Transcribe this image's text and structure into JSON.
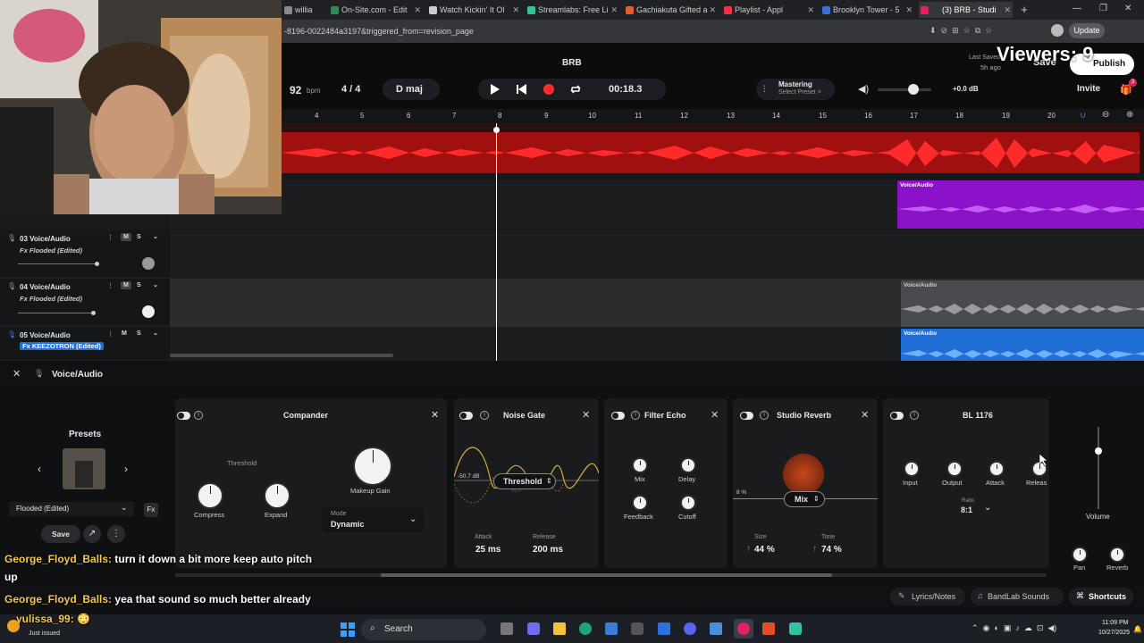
{
  "browser": {
    "tabs": [
      {
        "title": "willia",
        "color": "#8a8a8a"
      },
      {
        "title": "On-Site.com - Edit",
        "color": "#2e8b57"
      },
      {
        "title": "Watch Kickin' It Ol",
        "color": "#cccccc"
      },
      {
        "title": "Streamlabs: Free Li",
        "color": "#31c3a2"
      },
      {
        "title": "Gachiakuta Gifted a",
        "color": "#e65c2e"
      },
      {
        "title": "Playlist - Appl",
        "color": "#fa2d48"
      },
      {
        "title": "Brooklyn Tower - 5",
        "color": "#3b6fd8"
      },
      {
        "title": "(3) BRB - Studi",
        "color": "#e0245e"
      }
    ],
    "url": "-8196-0022484a3197&triggered_from=revision_page",
    "update_label": "Update"
  },
  "stream": {
    "viewers_label": "Viewers: 9"
  },
  "header": {
    "title": "BRB",
    "bpm_value": "92",
    "bpm_unit": "bpm",
    "time_signature": "4 / 4",
    "key": "D maj",
    "time": "00:18.3",
    "mastering_label": "Mastering",
    "mastering_preset": "Select Preset >",
    "master_volume": "+0.0 dB",
    "last_saved_label": "Last Saved",
    "last_saved_time": "5h ago",
    "save_label": "Save",
    "publish_label": "Publish",
    "invite_label": "Invite",
    "notification_count": "3"
  },
  "ruler": {
    "marks": [
      "4",
      "5",
      "6",
      "7",
      "8",
      "9",
      "10",
      "11",
      "12",
      "13",
      "14",
      "15",
      "16",
      "17",
      "18",
      "19",
      "20"
    ]
  },
  "tracks": [
    {
      "number": "03",
      "name": "Voice/Audio",
      "fx": "Fx Flooded (Edited)",
      "mute": "M",
      "solo": "S"
    },
    {
      "number": "04",
      "name": "Voice/Audio",
      "fx": "Fx Flooded (Edited)",
      "mute": "M",
      "solo": "S"
    },
    {
      "number": "05",
      "name": "Voice/Audio",
      "fx": "Fx KEEZOTRON (Edited)",
      "mute": "M",
      "solo": "S"
    }
  ],
  "clips": {
    "purple_label": "Voice/Audio",
    "grey_label": "Voice/Audio",
    "blue_label": "Voice/Audio"
  },
  "fx_panel": {
    "track_title": "Voice/Audio",
    "presets_label": "Presets",
    "preset_name": "Flooded (Edited)",
    "save_label": "Save",
    "compander": {
      "title": "Compander",
      "threshold_label": "Threshold",
      "compress_label": "Compress",
      "expand_label": "Expand",
      "makeup_label": "Makeup Gain",
      "mode_label": "Mode",
      "mode_value": "Dynamic"
    },
    "noise_gate": {
      "title": "Noise Gate",
      "db_value": "-50.7 dB",
      "param_label": "Threshold",
      "attack_label": "Attack",
      "attack_value": "25 ms",
      "release_label": "Release",
      "release_value": "200 ms"
    },
    "filter_echo": {
      "title": "Filter Echo",
      "mix_label": "Mix",
      "delay_label": "Delay",
      "feedback_label": "Feedback",
      "cutoff_label": "Cutoff"
    },
    "studio_reverb": {
      "title": "Studio Reverb",
      "mix_value": "8 %",
      "param_label": "Mix",
      "size_label": "Size",
      "size_value": "44 %",
      "tone_label": "Tone",
      "tone_value": "74 %"
    },
    "bl1176": {
      "title": "BL 1176",
      "input_label": "Input",
      "output_label": "Output",
      "attack_label": "Attack",
      "release_label": "Releas",
      "ratio_label": "Ratio",
      "ratio_value": "8:1"
    },
    "volume_label": "Volume",
    "pan_label": "Pan",
    "reverb_label": "Reverb"
  },
  "bottom_bar": {
    "lyrics_label": "Lyrics/Notes",
    "sounds_label": "BandLab Sounds",
    "shortcuts_label": "Shortcuts"
  },
  "chat": [
    {
      "user": "George_Floyd_Balls:",
      "message": "turn it down a bit more keep auto pitch"
    },
    {
      "user": "",
      "message": "up"
    },
    {
      "user": "George_Floyd_Balls:",
      "message": "yea that sound so much better already"
    },
    {
      "user": "yulissa_99:",
      "message": "😳"
    }
  ],
  "taskbar": {
    "search_label": "Search",
    "time": "11:09 PM",
    "date": "10/27/2025",
    "notice": "Just issued"
  },
  "colors": {
    "red_track": "#e21b1b",
    "purple_clip": "#8b12c9",
    "blue_clip": "#1f6fd6",
    "chat_user": "#f7c948",
    "record": "#ff2a2a"
  }
}
